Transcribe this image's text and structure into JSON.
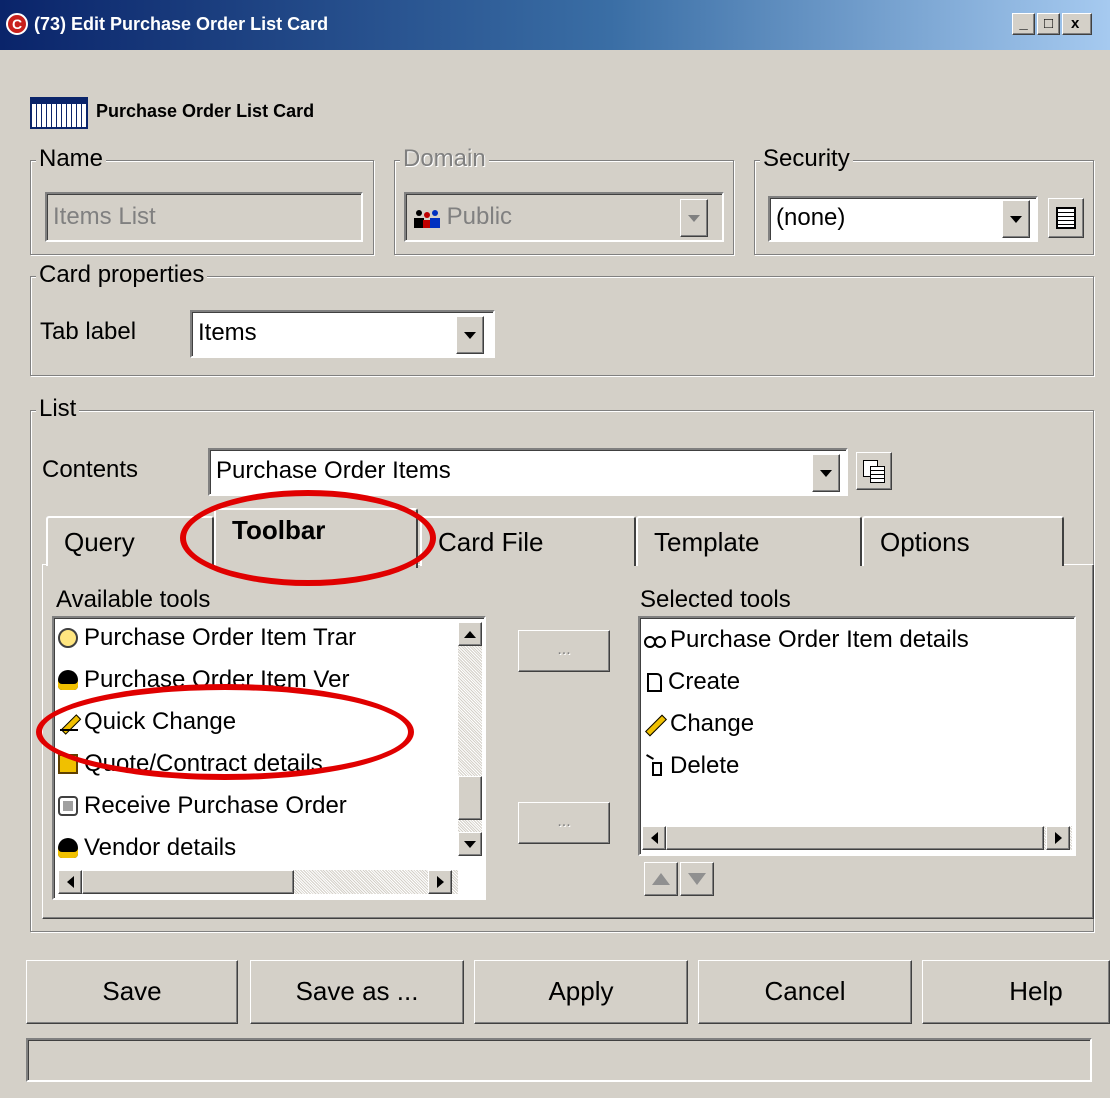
{
  "window": {
    "title": "(73) Edit Purchase Order List Card",
    "minimize": "_",
    "maximize": "□",
    "close": "x"
  },
  "header": {
    "title": "Purchase Order List Card"
  },
  "name_group": {
    "legend": "Name",
    "value": "Items List"
  },
  "domain_group": {
    "legend": "Domain",
    "value": "Public"
  },
  "security_group": {
    "legend": "Security",
    "value": "(none)"
  },
  "card_properties": {
    "legend": "Card properties",
    "tab_label_caption": "Tab label",
    "tab_label_value": "Items"
  },
  "list_group": {
    "legend": "List",
    "contents_caption": "Contents",
    "contents_value": "Purchase Order Items"
  },
  "tabs": [
    {
      "label": "Query"
    },
    {
      "label": "Toolbar"
    },
    {
      "label": "Card File"
    },
    {
      "label": "Template"
    },
    {
      "label": "Options"
    }
  ],
  "toolbar_tab": {
    "available_caption": "Available tools",
    "selected_caption": "Selected tools",
    "add_button": "...",
    "remove_button": "...",
    "available_items": [
      {
        "label": "Purchase Order Item Trar",
        "icon": "transfer-icon"
      },
      {
        "label": "Purchase Order Item Ver",
        "icon": "vendor-check-icon"
      },
      {
        "label": "Quick Change",
        "icon": "quick-change-icon"
      },
      {
        "label": "Quote/Contract details",
        "icon": "contract-icon"
      },
      {
        "label": "Receive Purchase Order",
        "icon": "receive-icon"
      },
      {
        "label": "Vendor details",
        "icon": "vendor-icon"
      }
    ],
    "selected_items": [
      {
        "label": "Purchase Order Item details",
        "icon": "glasses-icon"
      },
      {
        "label": "Create",
        "icon": "new-document-icon"
      },
      {
        "label": "Change",
        "icon": "pencil-icon"
      },
      {
        "label": "Delete",
        "icon": "delete-icon"
      }
    ]
  },
  "buttons": {
    "save": "Save",
    "save_as": "Save as ...",
    "apply": "Apply",
    "cancel": "Cancel",
    "help": "Help"
  },
  "status_bar": {
    "text": ""
  },
  "colors": {
    "annotation": "#e00000",
    "title_bar": "#0a246a",
    "face": "#d4d0c8"
  }
}
